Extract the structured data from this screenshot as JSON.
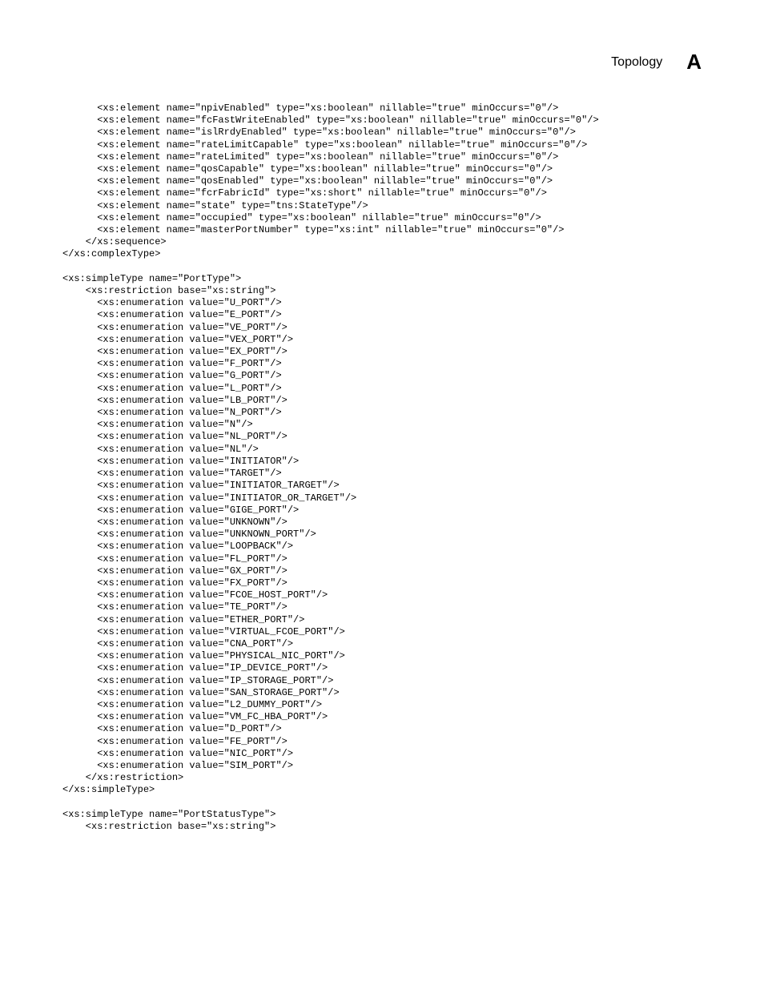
{
  "header": {
    "title": "Topology",
    "letter": "A"
  },
  "code_lines": [
    "      <xs:element name=\"npivEnabled\" type=\"xs:boolean\" nillable=\"true\" minOccurs=\"0\"/>",
    "      <xs:element name=\"fcFastWriteEnabled\" type=\"xs:boolean\" nillable=\"true\" minOccurs=\"0\"/>",
    "      <xs:element name=\"islRrdyEnabled\" type=\"xs:boolean\" nillable=\"true\" minOccurs=\"0\"/>",
    "      <xs:element name=\"rateLimitCapable\" type=\"xs:boolean\" nillable=\"true\" minOccurs=\"0\"/>",
    "      <xs:element name=\"rateLimited\" type=\"xs:boolean\" nillable=\"true\" minOccurs=\"0\"/>",
    "      <xs:element name=\"qosCapable\" type=\"xs:boolean\" nillable=\"true\" minOccurs=\"0\"/>",
    "      <xs:element name=\"qosEnabled\" type=\"xs:boolean\" nillable=\"true\" minOccurs=\"0\"/>",
    "      <xs:element name=\"fcrFabricId\" type=\"xs:short\" nillable=\"true\" minOccurs=\"0\"/>",
    "      <xs:element name=\"state\" type=\"tns:StateType\"/>",
    "      <xs:element name=\"occupied\" type=\"xs:boolean\" nillable=\"true\" minOccurs=\"0\"/>",
    "      <xs:element name=\"masterPortNumber\" type=\"xs:int\" nillable=\"true\" minOccurs=\"0\"/>",
    "    </xs:sequence>",
    "</xs:complexType>",
    "",
    "<xs:simpleType name=\"PortType\">",
    "    <xs:restriction base=\"xs:string\">",
    "      <xs:enumeration value=\"U_PORT\"/>",
    "      <xs:enumeration value=\"E_PORT\"/>",
    "      <xs:enumeration value=\"VE_PORT\"/>",
    "      <xs:enumeration value=\"VEX_PORT\"/>",
    "      <xs:enumeration value=\"EX_PORT\"/>",
    "      <xs:enumeration value=\"F_PORT\"/>",
    "      <xs:enumeration value=\"G_PORT\"/>",
    "      <xs:enumeration value=\"L_PORT\"/>",
    "      <xs:enumeration value=\"LB_PORT\"/>",
    "      <xs:enumeration value=\"N_PORT\"/>",
    "      <xs:enumeration value=\"N\"/>",
    "      <xs:enumeration value=\"NL_PORT\"/>",
    "      <xs:enumeration value=\"NL\"/>",
    "      <xs:enumeration value=\"INITIATOR\"/>",
    "      <xs:enumeration value=\"TARGET\"/>",
    "      <xs:enumeration value=\"INITIATOR_TARGET\"/>",
    "      <xs:enumeration value=\"INITIATOR_OR_TARGET\"/>",
    "      <xs:enumeration value=\"GIGE_PORT\"/>",
    "      <xs:enumeration value=\"UNKNOWN\"/>",
    "      <xs:enumeration value=\"UNKNOWN_PORT\"/>",
    "      <xs:enumeration value=\"LOOPBACK\"/>",
    "      <xs:enumeration value=\"FL_PORT\"/>",
    "      <xs:enumeration value=\"GX_PORT\"/>",
    "      <xs:enumeration value=\"FX_PORT\"/>",
    "      <xs:enumeration value=\"FCOE_HOST_PORT\"/>",
    "      <xs:enumeration value=\"TE_PORT\"/>",
    "      <xs:enumeration value=\"ETHER_PORT\"/>",
    "      <xs:enumeration value=\"VIRTUAL_FCOE_PORT\"/>",
    "      <xs:enumeration value=\"CNA_PORT\"/>",
    "      <xs:enumeration value=\"PHYSICAL_NIC_PORT\"/>",
    "      <xs:enumeration value=\"IP_DEVICE_PORT\"/>",
    "      <xs:enumeration value=\"IP_STORAGE_PORT\"/>",
    "      <xs:enumeration value=\"SAN_STORAGE_PORT\"/>",
    "      <xs:enumeration value=\"L2_DUMMY_PORT\"/>",
    "      <xs:enumeration value=\"VM_FC_HBA_PORT\"/>",
    "      <xs:enumeration value=\"D_PORT\"/>",
    "      <xs:enumeration value=\"FE_PORT\"/>",
    "      <xs:enumeration value=\"NIC_PORT\"/>",
    "      <xs:enumeration value=\"SIM_PORT\"/>",
    "    </xs:restriction>",
    "</xs:simpleType>",
    "",
    "<xs:simpleType name=\"PortStatusType\">",
    "    <xs:restriction base=\"xs:string\">"
  ]
}
